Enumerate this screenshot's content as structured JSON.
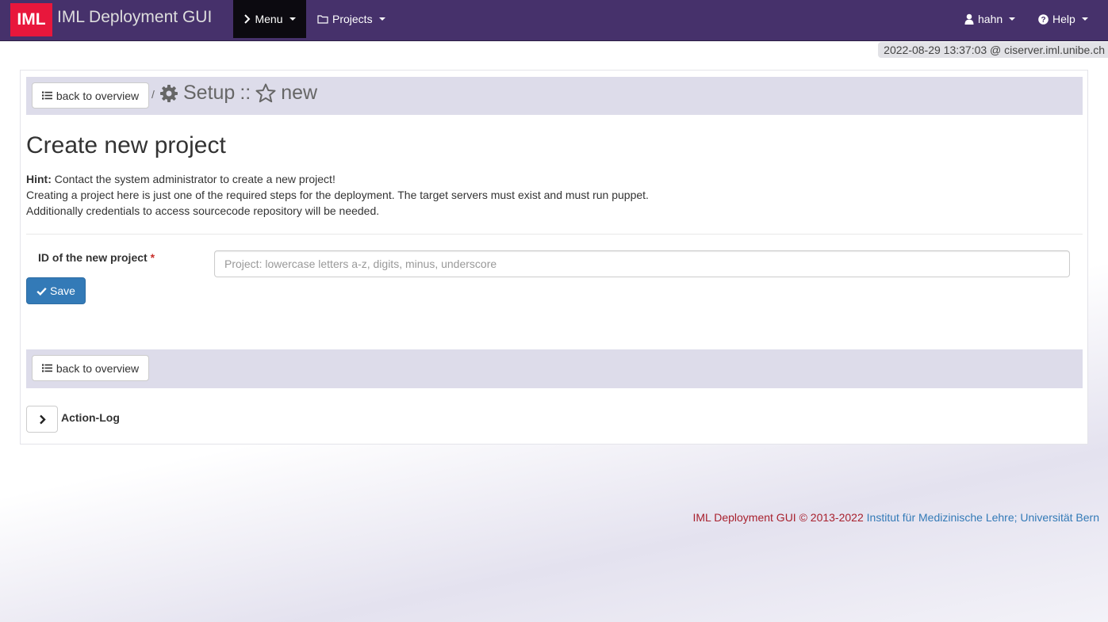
{
  "navbar": {
    "logo_text": "IML",
    "brand": "IML Deployment GUI",
    "menu_label": "Menu",
    "projects_label": "Projects",
    "user_label": "hahn",
    "help_label": "Help",
    "bg_color": "#46316b",
    "logo_color": "#e8173c"
  },
  "timestamp": "2022-08-29 13:37:03 @ ciserver.iml.unibe.ch",
  "breadcrumb": {
    "back_label": "back to overview",
    "separator": "/",
    "section": "Setup",
    "divider": "::",
    "current": "new"
  },
  "main": {
    "title": "Create new project",
    "hint_label": "Hint:",
    "hint_lines": [
      "Contact the system administrator to create a new project!",
      "Creating a project here is just one of the required steps for the deployment. The target servers must exist and must run puppet.",
      "Additionally credentials to access sourcecode repository will be needed."
    ],
    "field_label": "ID of the new project",
    "required_mark": "*",
    "field_value": "",
    "field_placeholder": "Project: lowercase letters a-z, digits, minus, underscore",
    "save_label": "Save"
  },
  "bottom_bar": {
    "back_label": "back to overview"
  },
  "action_log": {
    "label": "Action-Log"
  },
  "footer": {
    "app_text": "IML Deployment GUI © 2013-2022",
    "link_text": "Institut für Medizinische Lehre; Universität Bern"
  },
  "icons": [
    "chevron-right-icon",
    "folder-icon",
    "user-icon",
    "question-circle-icon",
    "list-icon",
    "gear-icon",
    "star-icon",
    "check-icon"
  ]
}
